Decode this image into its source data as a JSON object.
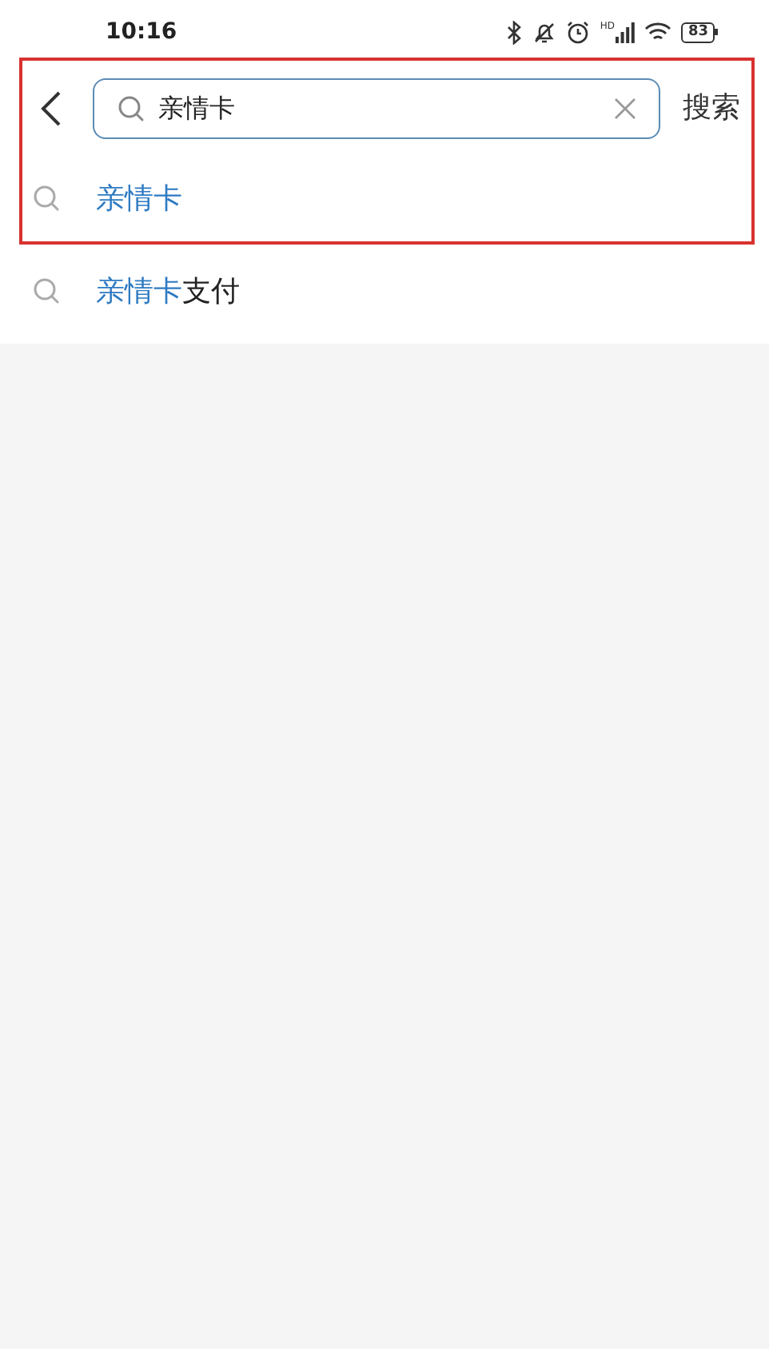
{
  "status_bar": {
    "time": "10:16",
    "signal_label": "HD",
    "battery": "83"
  },
  "search": {
    "value": "亲情卡",
    "submit": "搜索"
  },
  "suggestions": [
    {
      "match": "亲情卡"
    },
    {
      "match": "亲情卡",
      "rest": "支付"
    }
  ]
}
